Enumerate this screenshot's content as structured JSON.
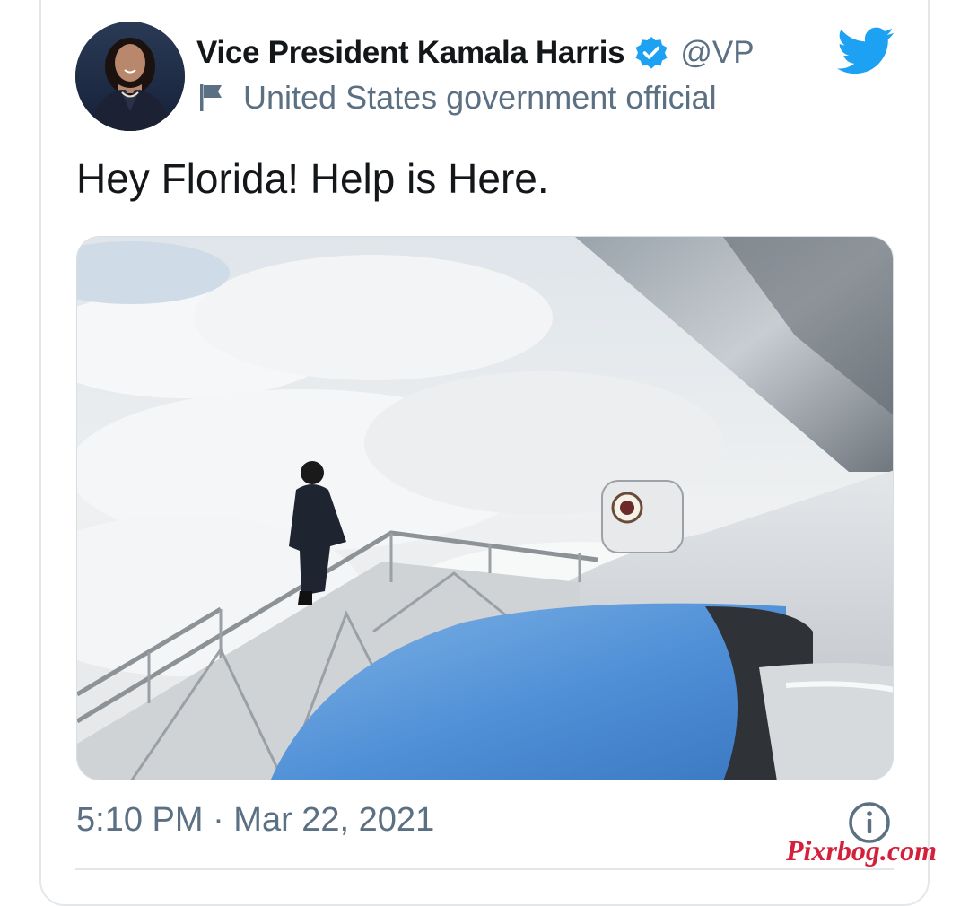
{
  "tweet": {
    "display_name": "Vice President Kamala Harris",
    "handle": "@VP",
    "account_label": "United States government official",
    "text": "Hey Florida! Help is Here.",
    "timestamp": "5:10 PM · Mar 22, 2021"
  },
  "icons": {
    "verified": "verified-badge-icon",
    "label": "flag-icon",
    "brand": "twitter-bird-icon",
    "info": "info-icon"
  },
  "colors": {
    "accent": "#1da1f2",
    "text": "#14171a",
    "secondary_text": "#5b7083",
    "watermark": "#d4213b"
  },
  "watermark": "Pixrbog.com"
}
